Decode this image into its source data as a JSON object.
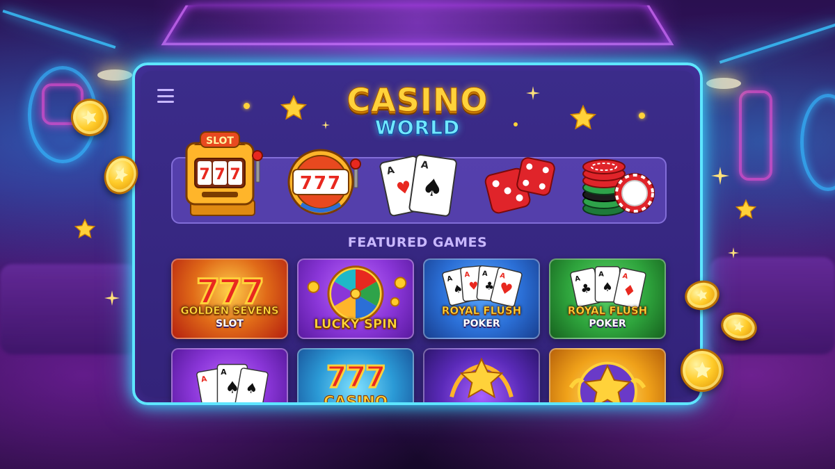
{
  "app": {
    "title_main": "CASINO",
    "title_sub": "WORLD"
  },
  "header": {
    "menu_icon": "hamburger-menu-icon"
  },
  "categories": [
    {
      "name": "slot-machine",
      "label": "SLOT",
      "icon": "slot-machine-icon"
    },
    {
      "name": "jackpot-slot",
      "label": "777",
      "icon": "slot-777-icon"
    },
    {
      "name": "cards",
      "label": "",
      "icon": "playing-cards-icon"
    },
    {
      "name": "dice",
      "label": "",
      "icon": "dice-icon"
    },
    {
      "name": "chips",
      "label": "",
      "icon": "poker-chips-icon"
    }
  ],
  "featured": {
    "title": "FEATURED GAMES",
    "games": [
      {
        "line1": "GOLDEN SEVENS",
        "line2": "SLOT",
        "art": "777",
        "theme": "red"
      },
      {
        "line1": "LUCKY SPIN",
        "line2": "",
        "art": "wheel",
        "theme": "purple"
      },
      {
        "line1": "ROYAL FLUSH",
        "line2": "POKER",
        "art": "cards",
        "theme": "blue"
      },
      {
        "line1": "ROYAL FLUSH",
        "line2": "POKER",
        "art": "cards",
        "theme": "green"
      },
      {
        "line1": "",
        "line2": "",
        "art": "cards",
        "theme": "purple"
      },
      {
        "line1": "CASINO",
        "line2": "",
        "art": "777",
        "theme": "blue"
      },
      {
        "line1": "",
        "line2": "",
        "art": "star",
        "theme": "purple"
      },
      {
        "line1": "",
        "line2": "",
        "art": "star",
        "theme": "gold"
      }
    ]
  },
  "colors": {
    "panel_border": "#5ee6ff",
    "title_gold": "#ffd23a",
    "title_cyan": "#6fe8ff",
    "card_red": "#d8381f",
    "card_purple": "#8a36d8",
    "card_blue": "#2b6fd6",
    "card_green": "#2ea33c",
    "card_gold": "#f0a21a"
  }
}
